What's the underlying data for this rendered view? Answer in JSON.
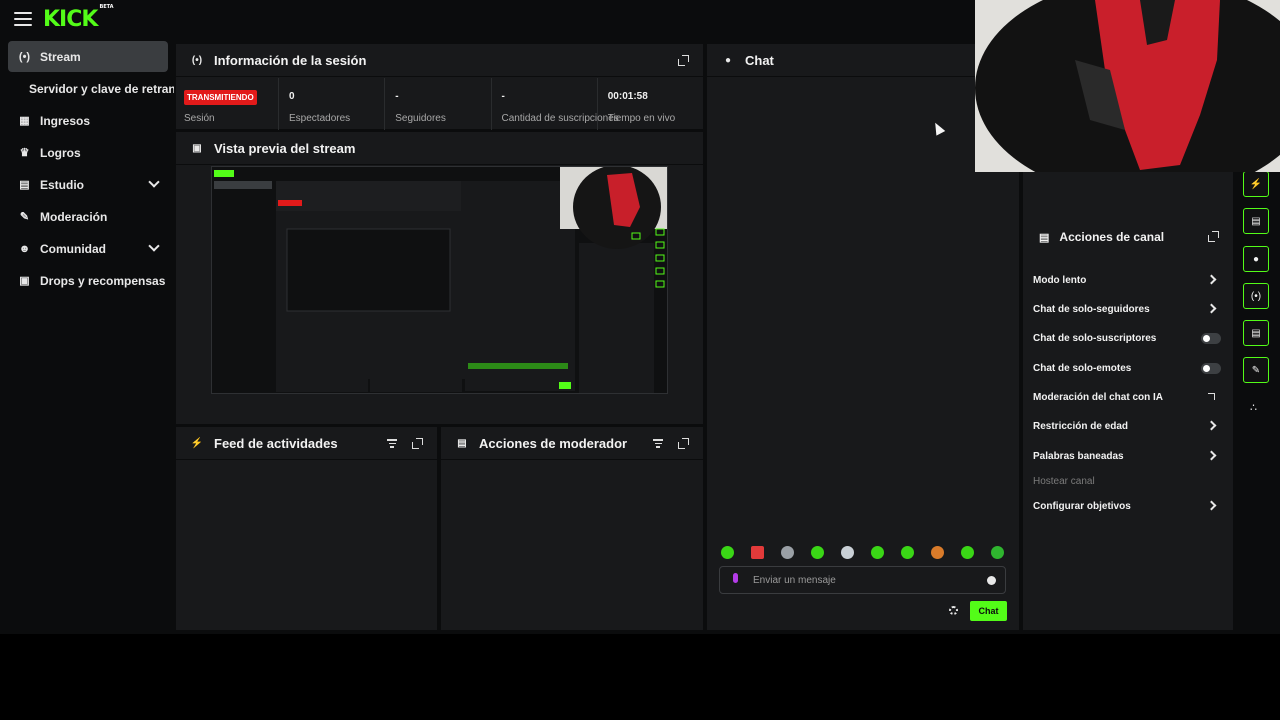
{
  "app": {
    "logo_text": "KICK",
    "logo_badge": "BETA",
    "accent": "#53fc18"
  },
  "sidebar": {
    "items": [
      {
        "label": "Stream",
        "icon": "broadcast-icon",
        "active": true
      },
      {
        "label": "Servidor y clave de retransmisión",
        "icon": "",
        "active": false
      },
      {
        "label": "Ingresos",
        "icon": "chart-icon",
        "active": false
      },
      {
        "label": "Logros",
        "icon": "trophy-icon",
        "active": false
      },
      {
        "label": "Estudio",
        "icon": "studio-icon",
        "active": false,
        "expandable": true
      },
      {
        "label": "Moderación",
        "icon": "wrench-icon",
        "active": false
      },
      {
        "label": "Comunidad",
        "icon": "people-icon",
        "active": false,
        "expandable": true
      },
      {
        "label": "Drops y recompensas",
        "icon": "gift-icon",
        "active": false
      }
    ]
  },
  "session": {
    "title": "Información de la sesión",
    "status_badge": "TRANSMITIENDO",
    "status_label": "Sesión",
    "stats": [
      {
        "value": "0",
        "label": "Espectadores"
      },
      {
        "value": "-",
        "label": "Seguidores"
      },
      {
        "value": "-",
        "label": "Cantidad de suscripciones"
      },
      {
        "value": "00:01:58",
        "label": "Tiempo en vivo"
      }
    ]
  },
  "preview": {
    "title": "Vista previa del stream"
  },
  "feed": {
    "title": "Feed de actividades"
  },
  "mod_actions": {
    "title": "Acciones de moderador"
  },
  "chat": {
    "title": "Chat",
    "input_placeholder": "Enviar un mensaje",
    "send_label": "Chat",
    "emote_count": 10
  },
  "channel_actions": {
    "title": "Acciones de canal",
    "items": [
      {
        "label": "Modo lento",
        "control": "arrow"
      },
      {
        "label": "Chat de solo-seguidores",
        "control": "arrow"
      },
      {
        "label": "Chat de solo-suscriptores",
        "control": "toggle",
        "state": "off"
      },
      {
        "label": "Chat de solo-emotes",
        "control": "toggle",
        "state": "off"
      },
      {
        "label": "Moderación del chat con IA",
        "control": "external"
      },
      {
        "label": "Restricción de edad",
        "control": "arrow"
      },
      {
        "label": "Palabras baneadas",
        "control": "arrow"
      },
      {
        "label": "Hostear canal",
        "control": "none",
        "disabled": true
      },
      {
        "label": "Configurar objetivos",
        "control": "arrow"
      }
    ]
  },
  "rail": {
    "buttons": [
      "lightning-icon",
      "document-icon",
      "chat-bubble-icon",
      "broadcast-icon",
      "list-icon",
      "wrench-icon",
      "dots-icon"
    ]
  }
}
